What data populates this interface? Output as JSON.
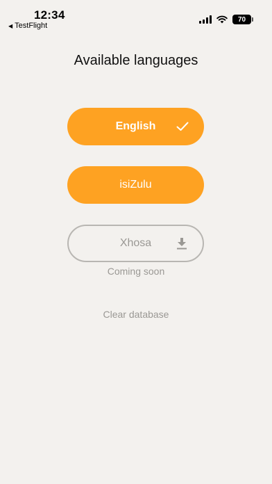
{
  "status_bar": {
    "time": "12:34",
    "back_app": "TestFlight",
    "battery": "70"
  },
  "page": {
    "title": "Available languages"
  },
  "languages": [
    {
      "label": "English",
      "state": "selected",
      "icon": "checkmark-icon"
    },
    {
      "label": "isiZulu",
      "state": "available"
    },
    {
      "label": "Xhosa",
      "state": "disabled",
      "icon": "download-icon",
      "note": "Coming soon"
    }
  ],
  "actions": {
    "clear_database": "Clear database"
  },
  "colors": {
    "accent": "#fea222",
    "background": "#f3f1ee",
    "muted": "#9a9894"
  }
}
